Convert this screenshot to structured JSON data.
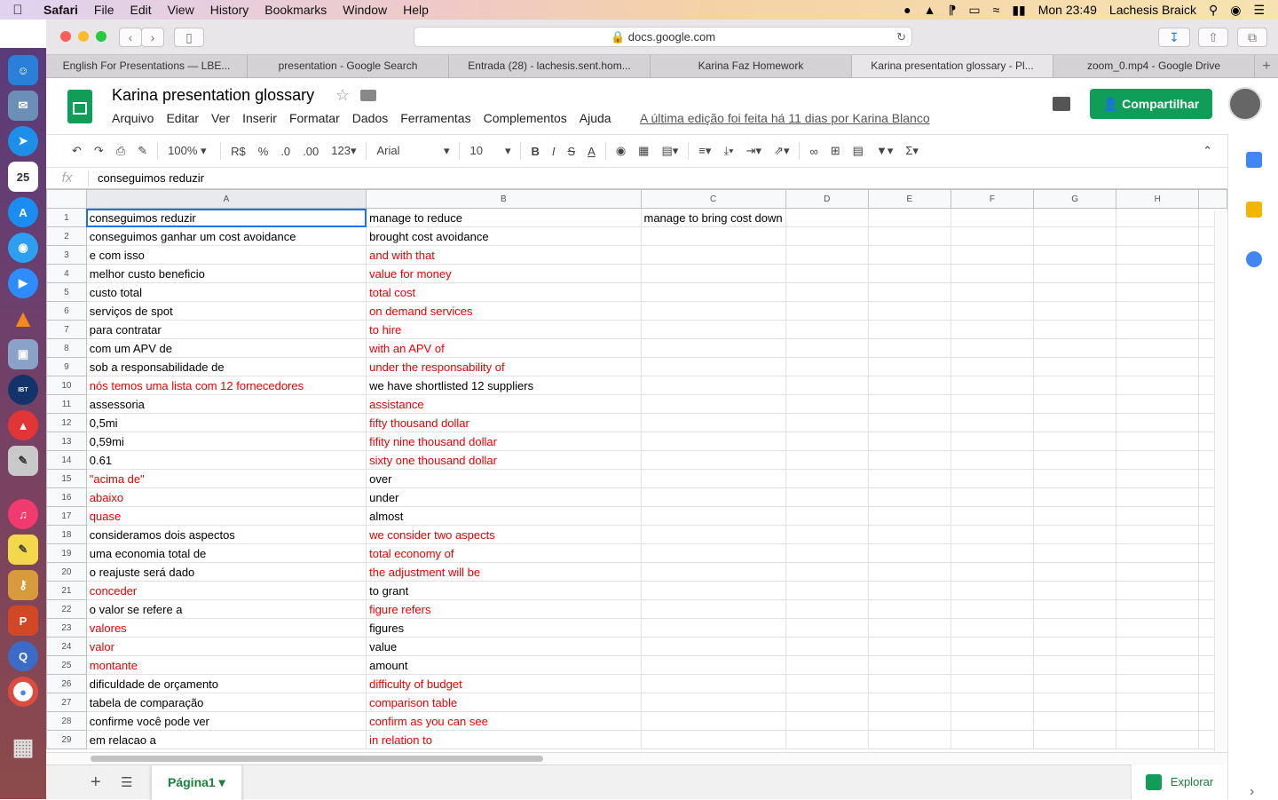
{
  "menubar": {
    "app": "Safari",
    "items": [
      "File",
      "Edit",
      "View",
      "History",
      "Bookmarks",
      "Window",
      "Help"
    ],
    "clock": "Mon 23:49",
    "user": "Lachesis Braick"
  },
  "browser": {
    "url": "docs.google.com",
    "tabs": [
      "English For Presentations — LBE...",
      "presentation - Google Search",
      "Entrada (28) - lachesis.sent.hom...",
      "Karina Faz Homework",
      "Karina presentation glossary - Pl...",
      "zoom_0.mp4 - Google Drive"
    ],
    "new_tab": "+"
  },
  "doc": {
    "title": "Karina presentation glossary",
    "menus": [
      "Arquivo",
      "Editar",
      "Ver",
      "Inserir",
      "Formatar",
      "Dados",
      "Ferramentas",
      "Complementos",
      "Ajuda"
    ],
    "last_edit": "A última edição foi feita há 11 dias por Karina Blanco",
    "share_label": "Compartilhar"
  },
  "format_toolbar": {
    "zoom": "100%",
    "currency": "R$",
    "percent": "%",
    "dec_less": ".0",
    "dec_more": ".00",
    "more_formats": "123",
    "font": "Arial",
    "font_size": "10",
    "bold": "B",
    "italic": "I",
    "strike": "S",
    "text_color": "A"
  },
  "formula_bar": {
    "fx": "fx",
    "value": "conseguimos reduzir"
  },
  "columns": [
    "A",
    "B",
    "C",
    "D",
    "E",
    "F",
    "G",
    "H"
  ],
  "rows": [
    {
      "n": "1",
      "a": "conseguimos reduzir",
      "b": "manage to reduce",
      "c": "manage to bring cost down",
      "ar": false,
      "br": false
    },
    {
      "n": "2",
      "a": "conseguimos ganhar um cost avoidance",
      "b": "brought cost avoidance",
      "c": "",
      "ar": false,
      "br": false
    },
    {
      "n": "3",
      "a": "e com isso",
      "b": "and with that",
      "c": "",
      "ar": false,
      "br": true
    },
    {
      "n": "4",
      "a": "melhor custo beneficio",
      "b": "value for money",
      "c": "",
      "ar": false,
      "br": true
    },
    {
      "n": "5",
      "a": "custo total",
      "b": "total cost",
      "c": "",
      "ar": false,
      "br": true
    },
    {
      "n": "6",
      "a": "serviços de spot",
      "b": "on demand services",
      "c": "",
      "ar": false,
      "br": true
    },
    {
      "n": "7",
      "a": "para contratar",
      "b": "to hire",
      "c": "",
      "ar": false,
      "br": true
    },
    {
      "n": "8",
      "a": "com um APV de",
      "b": "with an APV of",
      "c": "",
      "ar": false,
      "br": true
    },
    {
      "n": "9",
      "a": "sob a responsabilidade de",
      "b": "under the responsability of",
      "c": "",
      "ar": false,
      "br": true
    },
    {
      "n": "10",
      "a": "nós temos uma lista com 12 fornecedores",
      "b": "we have shortlisted 12 suppliers",
      "c": "",
      "ar": true,
      "br": false
    },
    {
      "n": "11",
      "a": "assessoria",
      "b": "assistance",
      "c": "",
      "ar": false,
      "br": true
    },
    {
      "n": "12",
      "a": "0,5mi",
      "b": "fifty thousand dollar",
      "c": "",
      "ar": false,
      "br": true
    },
    {
      "n": "13",
      "a": "0,59mi",
      "b": "fifity nine thousand dollar",
      "c": "",
      "ar": false,
      "br": true
    },
    {
      "n": "14",
      "a": "0.61",
      "b": "sixty one thousand dollar",
      "c": "",
      "ar": false,
      "br": true
    },
    {
      "n": "15",
      "a": "\"acima de\"",
      "b": "over",
      "c": "",
      "ar": true,
      "br": false
    },
    {
      "n": "16",
      "a": "abaixo",
      "b": "under",
      "c": "",
      "ar": true,
      "br": false
    },
    {
      "n": "17",
      "a": "quase",
      "b": "almost",
      "c": "",
      "ar": true,
      "br": false
    },
    {
      "n": "18",
      "a": "consideramos dois aspectos",
      "b": "we consider two aspects",
      "c": "",
      "ar": false,
      "br": true
    },
    {
      "n": "19",
      "a": "uma economia total de",
      "b": "total economy of",
      "c": "",
      "ar": false,
      "br": true
    },
    {
      "n": "20",
      "a": "o reajuste será dado",
      "b": "the adjustment will be",
      "c": "",
      "ar": false,
      "br": true
    },
    {
      "n": "21",
      "a": "conceder",
      "b": "to grant",
      "c": "",
      "ar": true,
      "br": false
    },
    {
      "n": "22",
      "a": "o valor se refere a",
      "b": "figure refers",
      "c": "",
      "ar": false,
      "br": true
    },
    {
      "n": "23",
      "a": "valores",
      "b": "figures",
      "c": "",
      "ar": true,
      "br": false
    },
    {
      "n": "24",
      "a": "valor",
      "b": "value",
      "c": "",
      "ar": true,
      "br": false
    },
    {
      "n": "25",
      "a": "montante",
      "b": "amount",
      "c": "",
      "ar": true,
      "br": false
    },
    {
      "n": "26",
      "a": "dificuldade de orçamento",
      "b": "difficulty of budget",
      "c": "",
      "ar": false,
      "br": true
    },
    {
      "n": "27",
      "a": "tabela de comparação",
      "b": "comparison table",
      "c": "",
      "ar": false,
      "br": true
    },
    {
      "n": "28",
      "a": "confirme você pode ver",
      "b": "confirm as you can see",
      "c": "",
      "ar": false,
      "br": true
    },
    {
      "n": "29",
      "a": "em relacao a",
      "b": "in relation to",
      "c": "",
      "ar": false,
      "br": true
    }
  ],
  "sheet": {
    "add": "+",
    "tab": "Página1",
    "explore": "Explorar"
  },
  "colors": {
    "accent_green": "#0f9d58",
    "red_text": "#ee0000",
    "selection": "#1a73e8"
  }
}
